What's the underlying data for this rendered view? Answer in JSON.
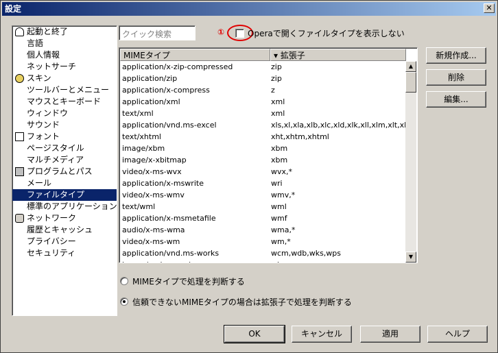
{
  "window": {
    "title": "設定",
    "close_symbol": "✕"
  },
  "sidebar": {
    "items": [
      {
        "label": "起動と終了",
        "type": "group",
        "icon": "person-icon",
        "selected": false
      },
      {
        "label": "言語",
        "type": "child",
        "selected": false
      },
      {
        "label": "個人情報",
        "type": "child",
        "selected": false
      },
      {
        "label": "ネットサーチ",
        "type": "child",
        "selected": false
      },
      {
        "label": "スキン",
        "type": "group",
        "icon": "eye-icon",
        "selected": false
      },
      {
        "label": "ツールバーとメニュー",
        "type": "child",
        "selected": false
      },
      {
        "label": "マウスとキーボード",
        "type": "child",
        "selected": false
      },
      {
        "label": "ウィンドウ",
        "type": "child",
        "selected": false
      },
      {
        "label": "サウンド",
        "type": "child",
        "selected": false
      },
      {
        "label": "フォント",
        "type": "group",
        "icon": "document-icon",
        "selected": false
      },
      {
        "label": "ページスタイル",
        "type": "child",
        "selected": false
      },
      {
        "label": "マルチメディア",
        "type": "child",
        "selected": false
      },
      {
        "label": "プログラムとパス",
        "type": "group",
        "icon": "floppy-disk-icon",
        "selected": false
      },
      {
        "label": "メール",
        "type": "child",
        "selected": false
      },
      {
        "label": "ファイルタイプ",
        "type": "child",
        "selected": true
      },
      {
        "label": "標準のアプリケーション",
        "type": "child",
        "selected": false
      },
      {
        "label": "ネットワーク",
        "type": "group",
        "icon": "padlock-icon",
        "selected": false
      },
      {
        "label": "履歴とキャッシュ",
        "type": "child",
        "selected": false
      },
      {
        "label": "プライバシー",
        "type": "child",
        "selected": false
      },
      {
        "label": "セキュリティ",
        "type": "child",
        "selected": false
      }
    ]
  },
  "search": {
    "placeholder": "クイック検索"
  },
  "annotation": {
    "number": "①",
    "color": "#e00000"
  },
  "checkbox": {
    "label": "Operaで開くファイルタイプを表示しない",
    "checked": false
  },
  "table": {
    "headers": [
      "MIMEタイプ",
      "▾ 拡張子"
    ],
    "rows": [
      [
        "application/x-zip-compressed",
        "zip"
      ],
      [
        "application/zip",
        "zip"
      ],
      [
        "application/x-compress",
        "z"
      ],
      [
        "application/xml",
        "xml"
      ],
      [
        "text/xml",
        "xml"
      ],
      [
        "application/vnd.ms-excel",
        "xls,xl,xla,xlb,xlc,xld,xlk,xll,xlm,xlt,xlv,xlw"
      ],
      [
        "text/xhtml",
        "xht,xhtm,xhtml"
      ],
      [
        "image/xbm",
        "xbm"
      ],
      [
        "image/x-xbitmap",
        "xbm"
      ],
      [
        "video/x-ms-wvx",
        "wvx,*"
      ],
      [
        "application/x-mswrite",
        "wri"
      ],
      [
        "video/x-ms-wmv",
        "wmv,*"
      ],
      [
        "text/wml",
        "wml"
      ],
      [
        "application/x-msmetafile",
        "wmf"
      ],
      [
        "audio/x-ms-wma",
        "wma,*"
      ],
      [
        "video/x-ms-wm",
        "wm,*"
      ],
      [
        "application/vnd.ms-works",
        "wcm,wdb,wks,wps"
      ],
      [
        "image/vnd.wap.wbmp",
        "wbmp"
      ]
    ],
    "scroll_up": "▲",
    "scroll_down": "▼"
  },
  "side_buttons": {
    "new": "新規作成...",
    "delete": "削除",
    "edit": "編集..."
  },
  "radios": [
    {
      "label": "MIMEタイプで処理を判断する",
      "checked": false
    },
    {
      "label": "信頼できないMIMEタイプの場合は拡張子で処理を判断する",
      "checked": true
    }
  ],
  "footer": {
    "ok": "OK",
    "cancel": "キャンセル",
    "apply": "適用",
    "help": "ヘルプ"
  }
}
